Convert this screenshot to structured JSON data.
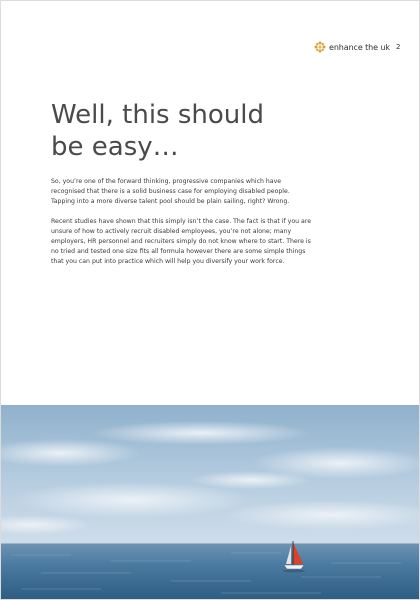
{
  "header": {
    "brand_name": "enhance the uk",
    "page_number": "2",
    "brand_icon": "flower-logo-icon",
    "brand_color": "#d9a13b"
  },
  "article": {
    "heading_line1": "Well, this should",
    "heading_line2": "be easy…",
    "paragraph1": "So, you’re one of the forward thinking, progressive companies which have recognised that there is a solid business case for employing disabled people. Tapping into a more diverse talent pool should be plain sailing, right? Wrong.",
    "paragraph2": "Recent studies have shown that this simply isn’t the case. The fact is that if you are unsure of how to actively recruit disabled employees, you’re not alone; many employers, HR personnel and recruiters simply do not know where to start. There is no tried and tested one size fits all formula however there are some simple things that you can put into practice which will help you diversify your work force."
  },
  "photo": {
    "subject": "sailboat with red sail on open sea under cloudy sky",
    "sky_color": "#a8c4dc",
    "sea_color": "#3f6f96",
    "sail_color": "#d8432a"
  }
}
